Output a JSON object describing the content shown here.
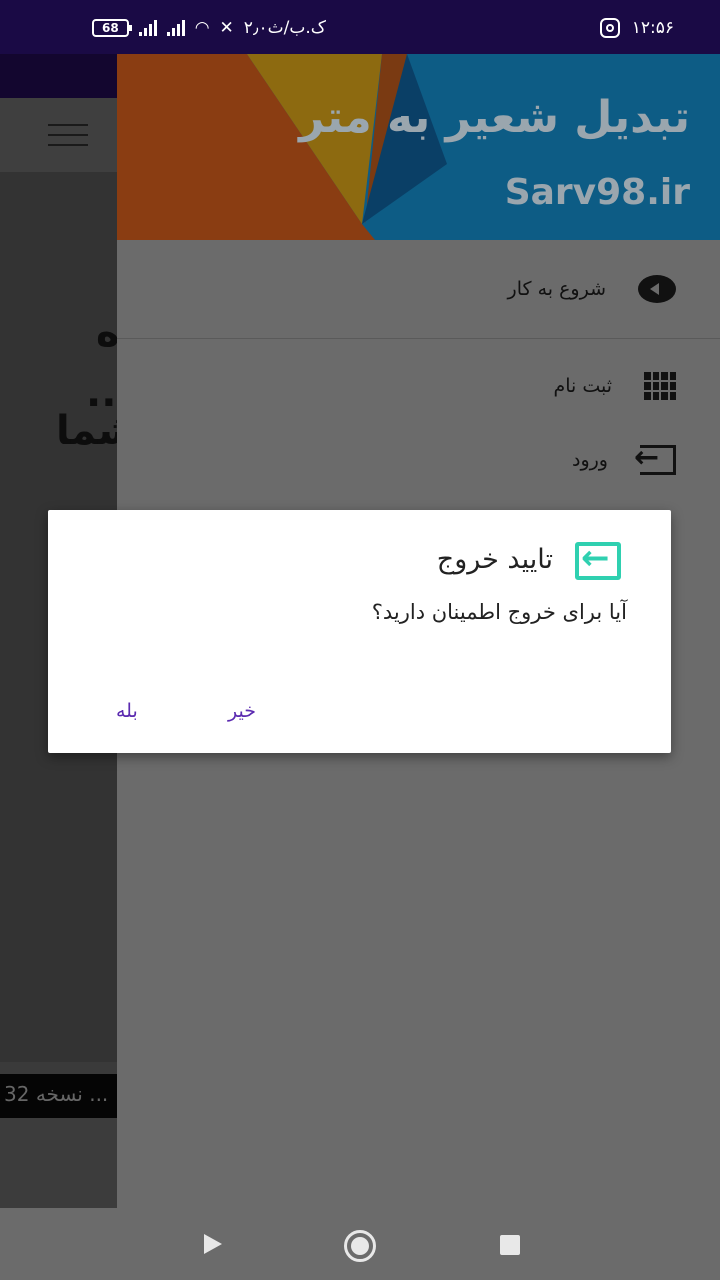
{
  "status_bar": {
    "time": "۱۲:۵۶",
    "battery": "68",
    "network_speed": "۲٫۰ک.ب/ث",
    "icons": [
      "battery-icon",
      "signal-icon",
      "signal-icon",
      "wifi-icon",
      "bell-muted-icon",
      "instagram-icon"
    ]
  },
  "background": {
    "text_lines": [
      "ه",
      "..",
      "شما"
    ],
    "footer_text": "32 نسخه ..."
  },
  "drawer": {
    "header_title": "تبدیل شعیر به متر",
    "header_site": "Sarv98.ir",
    "items": [
      {
        "label": "شروع به کار",
        "icon": "start-icon"
      },
      {
        "label": "ثبت نام",
        "icon": "grid-icon"
      },
      {
        "label": "ورود",
        "icon": "login-icon"
      }
    ]
  },
  "dialog": {
    "title": "تایید خروج",
    "message": "آیا برای خروج اطمینان دارید؟",
    "buttons": {
      "no": "خیر",
      "yes": "بله"
    },
    "accent_color": "#2fd0b0",
    "button_color": "#5b2ab0"
  },
  "nav_bar": {
    "icons": [
      "back-icon",
      "home-icon",
      "recents-icon"
    ]
  }
}
